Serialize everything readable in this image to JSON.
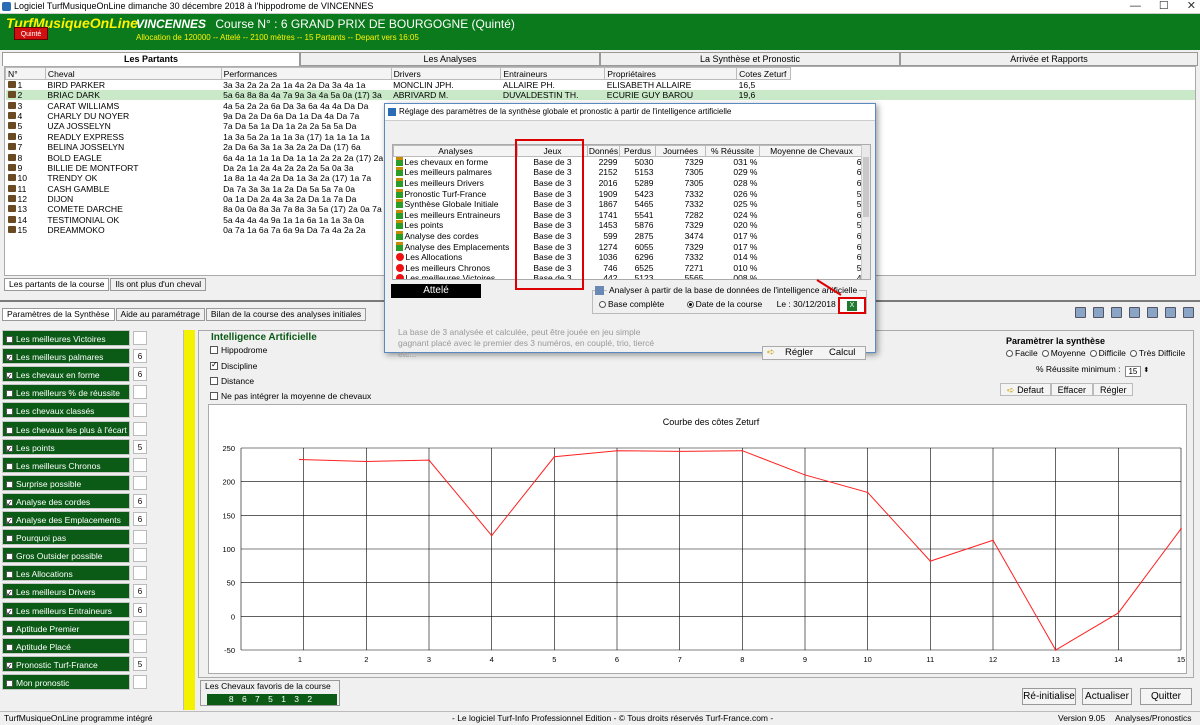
{
  "window": {
    "title": "Logiciel TurfMusiqueOnLine dimanche 30 décembre 2018 à l'hippodrome de VINCENNES",
    "controls": [
      "—",
      "☐",
      "✕"
    ]
  },
  "header": {
    "app_name": "TurfMusiqueOnLine",
    "quinte_label": "Quinté",
    "venue": "VINCENNES",
    "course": "Course N° : 6 GRAND PRIX DE BOURGOGNE (Quinté)",
    "details": "Allocation de 120000 -- Attelé -- 2100 mètres -- 15 Partants -- Depart vers 16:05"
  },
  "main_tabs": [
    "Les Partants",
    "Les Analyses",
    "La Synthèse et Pronostic",
    "Arrivée et Rapports"
  ],
  "partants": {
    "columns": [
      "N°",
      "Cheval",
      "Performances",
      "Drivers",
      "Entraineurs",
      "Propriétaires",
      "Cotes Zeturf"
    ],
    "rows": [
      {
        "num": "1",
        "name": "BIRD PARKER",
        "perf": "3a 3a 2a 2a 2a 1a 4a 2a Da 3a 4a 1a",
        "driver": "MONCLIN JPH.",
        "trainer": "ALLAIRE PH.",
        "owner": "ELISABETH ALLAIRE",
        "cote": "16,5"
      },
      {
        "num": "2",
        "name": "BRIAC DARK",
        "perf": "5a 6a 8a 8a 4a 7a 9a 3a 4a 5a 0a (17) 3a",
        "driver": "ABRIVARD M.",
        "trainer": "DUVALDESTIN TH.",
        "owner": "ECURIE GUY BAROU",
        "cote": "19,6"
      },
      {
        "num": "3",
        "name": "CARAT WILLIAMS",
        "perf": "4a 5a 2a 2a 6a Da 3a 6a 4a 4a Da Da",
        "driver": "",
        "trainer": "",
        "owner": "",
        "cote": ""
      },
      {
        "num": "4",
        "name": "CHARLY DU NOYER",
        "perf": "9a Da 2a Da 6a Da 1a Da 4a Da 7a",
        "driver": "",
        "trainer": "",
        "owner": "",
        "cote": ""
      },
      {
        "num": "5",
        "name": "UZA JOSSELYN",
        "perf": "7a Da 5a 1a Da 1a 2a 2a 5a 5a Da",
        "driver": "",
        "trainer": "",
        "owner": "",
        "cote": ""
      },
      {
        "num": "6",
        "name": "READLY EXPRESS",
        "perf": "1a 3a 5a 2a 1a 1a 3a (17) 1a 1a 1a 1a",
        "driver": "",
        "trainer": "",
        "owner": "",
        "cote": ""
      },
      {
        "num": "7",
        "name": "BELINA JOSSELYN",
        "perf": "2a Da 6a 3a 1a 3a 2a 2a Da (17) 6a",
        "driver": "",
        "trainer": "",
        "owner": "",
        "cote": ""
      },
      {
        "num": "8",
        "name": "BOLD EAGLE",
        "perf": "6a 4a 1a 1a 1a Da 1a 1a 2a 2a 2a (17) 2a",
        "driver": "",
        "trainer": "",
        "owner": "",
        "cote": ""
      },
      {
        "num": "9",
        "name": "BILLIE DE MONTFORT",
        "perf": "Da 2a 1a 2a 4a 2a 2a 2a 5a 0a 3a",
        "driver": "",
        "trainer": "",
        "owner": "",
        "cote": ""
      },
      {
        "num": "10",
        "name": "TRENDY OK",
        "perf": "1a 8a 1a 4a 2a Da 1a 3a 2a (17) 1a 7a",
        "driver": "",
        "trainer": "",
        "owner": "",
        "cote": ""
      },
      {
        "num": "11",
        "name": "CASH GAMBLE",
        "perf": "Da 7a 3a 3a 1a 2a Da 5a 5a 7a 0a",
        "driver": "",
        "trainer": "",
        "owner": "",
        "cote": ""
      },
      {
        "num": "12",
        "name": "DIJON",
        "perf": "0a 1a Da 2a 4a 3a 2a Da 1a 7a Da",
        "driver": "",
        "trainer": "",
        "owner": "",
        "cote": ""
      },
      {
        "num": "13",
        "name": "COMETE DARCHE",
        "perf": "8a 0a 0a 8a 3a 7a 8a 3a 5a (17) 2a 0a 7a",
        "driver": "",
        "trainer": "",
        "owner": "",
        "cote": ""
      },
      {
        "num": "14",
        "name": "TESTIMONIAL OK",
        "perf": "5a 4a 4a 4a 9a 1a 1a 6a 1a 1a 3a 0a",
        "driver": "",
        "trainer": "",
        "owner": "",
        "cote": ""
      },
      {
        "num": "15",
        "name": "DREAMMOKO",
        "perf": "0a 7a 1a 6a 7a 6a 9a Da 7a 4a 2a 2a",
        "driver": "",
        "trainer": "",
        "owner": "",
        "cote": ""
      }
    ]
  },
  "subtabs_partants": [
    "Les partants de la course",
    "Ils ont plus d'un cheval"
  ],
  "subtabs_synthese": [
    "Paramètres de la Synthèse",
    "Aide au paramétrage",
    "Bilan de la course des analyses initiales"
  ],
  "analyses_list": [
    {
      "label": "Les meilleures Victoires",
      "checked": false,
      "value": ""
    },
    {
      "label": "Les meilleurs palmares",
      "checked": true,
      "value": "6"
    },
    {
      "label": "Les chevaux en forme",
      "checked": true,
      "value": "6"
    },
    {
      "label": "Les meilleurs % de réussite",
      "checked": false,
      "value": ""
    },
    {
      "label": "Les chevaux classés",
      "checked": false,
      "value": ""
    },
    {
      "label": "Les chevaux les plus à l'écart",
      "checked": false,
      "value": ""
    },
    {
      "label": "Les points",
      "checked": true,
      "value": "5"
    },
    {
      "label": "Les meilleurs Chronos",
      "checked": false,
      "value": ""
    },
    {
      "label": "Surprise possible",
      "checked": false,
      "value": ""
    },
    {
      "label": "Analyse des cordes",
      "checked": true,
      "value": "6"
    },
    {
      "label": "Analyse des Emplacements",
      "checked": true,
      "value": "6"
    },
    {
      "label": "Pourquoi pas",
      "checked": false,
      "value": ""
    },
    {
      "label": "Gros Outsider possible",
      "checked": false,
      "value": ""
    },
    {
      "label": "Les Allocations",
      "checked": false,
      "value": ""
    },
    {
      "label": "Les meilleurs  Drivers",
      "checked": true,
      "value": "6"
    },
    {
      "label": "Les meilleurs Entraineurs",
      "checked": true,
      "value": "6"
    },
    {
      "label": "Aptitude Premier",
      "checked": false,
      "value": ""
    },
    {
      "label": "Aptitude Placé",
      "checked": false,
      "value": ""
    },
    {
      "label": "Pronostic Turf-France",
      "checked": true,
      "value": "5"
    },
    {
      "label": "Mon pronostic",
      "checked": false,
      "value": ""
    }
  ],
  "ia": {
    "title": "Intelligence Artificielle",
    "options": [
      {
        "label": "Hippodrome",
        "checked": false
      },
      {
        "label": "Discipline",
        "checked": true
      },
      {
        "label": "Distance",
        "checked": false
      },
      {
        "label": "Ne pas intégrer la moyenne de chevaux",
        "checked": false
      }
    ]
  },
  "param_synthese": {
    "title": "Paramètrer la synthèse",
    "levels": [
      {
        "label": "Facile",
        "selected": false
      },
      {
        "label": "Moyenne",
        "selected": false
      },
      {
        "label": "Difficile",
        "selected": false
      },
      {
        "label": "Très Difficile",
        "selected": false
      }
    ],
    "pct_label": "% Réussite minimum :",
    "pct_value": "15",
    "buttons": [
      "Defaut",
      "Effacer",
      "Régler"
    ]
  },
  "chart_data": {
    "type": "line",
    "title": "Courbe des côtes Zeturf",
    "x": [
      1,
      2,
      3,
      4,
      5,
      6,
      7,
      8,
      9,
      10,
      11,
      12,
      13,
      14,
      15
    ],
    "values": [
      233,
      230,
      232,
      120,
      237,
      246,
      245,
      246,
      210,
      184,
      82,
      113,
      -50,
      5,
      130
    ],
    "yticks": [
      250,
      200,
      150,
      100,
      50,
      0,
      -50
    ],
    "xticks": [
      "1",
      "2",
      "3",
      "4",
      "5",
      "6",
      "7",
      "8",
      "9",
      "10",
      "11",
      "12",
      "13",
      "14",
      "15"
    ],
    "ylim": [
      -50,
      250
    ],
    "grid": true,
    "line_color": "#ff2020"
  },
  "favoris": {
    "label": "Les Chevaux favoris de la course",
    "value": "8 6 7 5 1 3 2"
  },
  "buttons": {
    "reinit": "Ré-initialise",
    "actualiser": "Actualiser",
    "quitter": "Quitter"
  },
  "status": {
    "left": "TurfMusiqueOnLine programme intégré",
    "center": "- Le logiciel Turf-Info Professionnel Edition - © Tous droits réservés Turf-France.com -",
    "version": "Version 9.05",
    "section": "Analyses/Pronostics"
  },
  "dialog": {
    "title": "Réglage des paramètres de la synthèse globale et pronostic à partir de l'intelligence artificielle",
    "columns": [
      "Analyses",
      "Jeux",
      "Donnés",
      "Perdus",
      "Journées",
      "% Réussite",
      "Moyenne de Chevaux"
    ],
    "rows": [
      {
        "status": "go",
        "analyse": "Les chevaux en forme",
        "jeux": "Base de 3",
        "donnes": "2299",
        "perdus": "5030",
        "journees": "7329",
        "reussite": "031 %",
        "moyenne": "6"
      },
      {
        "status": "go",
        "analyse": "Les meilleurs palmares",
        "jeux": "Base de 3",
        "donnes": "2152",
        "perdus": "5153",
        "journees": "7305",
        "reussite": "029 %",
        "moyenne": "6"
      },
      {
        "status": "go",
        "analyse": "Les meilleurs  Drivers",
        "jeux": "Base de 3",
        "donnes": "2016",
        "perdus": "5289",
        "journees": "7305",
        "reussite": "028 %",
        "moyenne": "6"
      },
      {
        "status": "go",
        "analyse": "Pronostic Turf-France",
        "jeux": "Base de 3",
        "donnes": "1909",
        "perdus": "5423",
        "journees": "7332",
        "reussite": "026 %",
        "moyenne": "5"
      },
      {
        "status": "go",
        "analyse": "Synthèse Globale Initiale",
        "jeux": "Base de 3",
        "donnes": "1867",
        "perdus": "5465",
        "journees": "7332",
        "reussite": "025 %",
        "moyenne": "5"
      },
      {
        "status": "go",
        "analyse": "Les meilleurs Entraineurs",
        "jeux": "Base de 3",
        "donnes": "1741",
        "perdus": "5541",
        "journees": "7282",
        "reussite": "024 %",
        "moyenne": "6"
      },
      {
        "status": "go",
        "analyse": "Les points",
        "jeux": "Base de 3",
        "donnes": "1453",
        "perdus": "5876",
        "journees": "7329",
        "reussite": "020 %",
        "moyenne": "5"
      },
      {
        "status": "go",
        "analyse": "Analyse des cordes",
        "jeux": "Base de 3",
        "donnes": "599",
        "perdus": "2875",
        "journees": "3474",
        "reussite": "017 %",
        "moyenne": "6"
      },
      {
        "status": "go",
        "analyse": "Analyse des Emplacements",
        "jeux": "Base de 3",
        "donnes": "1274",
        "perdus": "6055",
        "journees": "7329",
        "reussite": "017 %",
        "moyenne": "6"
      },
      {
        "status": "stop",
        "analyse": "Les Allocations",
        "jeux": "Base de 3",
        "donnes": "1036",
        "perdus": "6296",
        "journees": "7332",
        "reussite": "014 %",
        "moyenne": "6"
      },
      {
        "status": "stop",
        "analyse": "Les meilleurs Chronos",
        "jeux": "Base de 3",
        "donnes": "746",
        "perdus": "6525",
        "journees": "7271",
        "reussite": "010 %",
        "moyenne": "5"
      },
      {
        "status": "stop",
        "analyse": "Les meilleures Victoires",
        "jeux": "Base de 3",
        "donnes": "442",
        "perdus": "5123",
        "journees": "5565",
        "reussite": "008 %",
        "moyenne": "4"
      }
    ],
    "discipline": "Attelé",
    "analyse_label": "Analyser à partir de la base de données de l'intelligence artificielle",
    "base_complete": "Base complète",
    "date_course": "Date de la course",
    "date_value": "Le : 30/12/2018",
    "excel_label": "X",
    "description": "La base de 3 analysée et calculée, peut être jouée en jeu simple gagnant placé avec le premier des 3 numéros, en couplé, trio, tiercé etc...",
    "regler": "Régler",
    "calcul": "Calcul"
  }
}
